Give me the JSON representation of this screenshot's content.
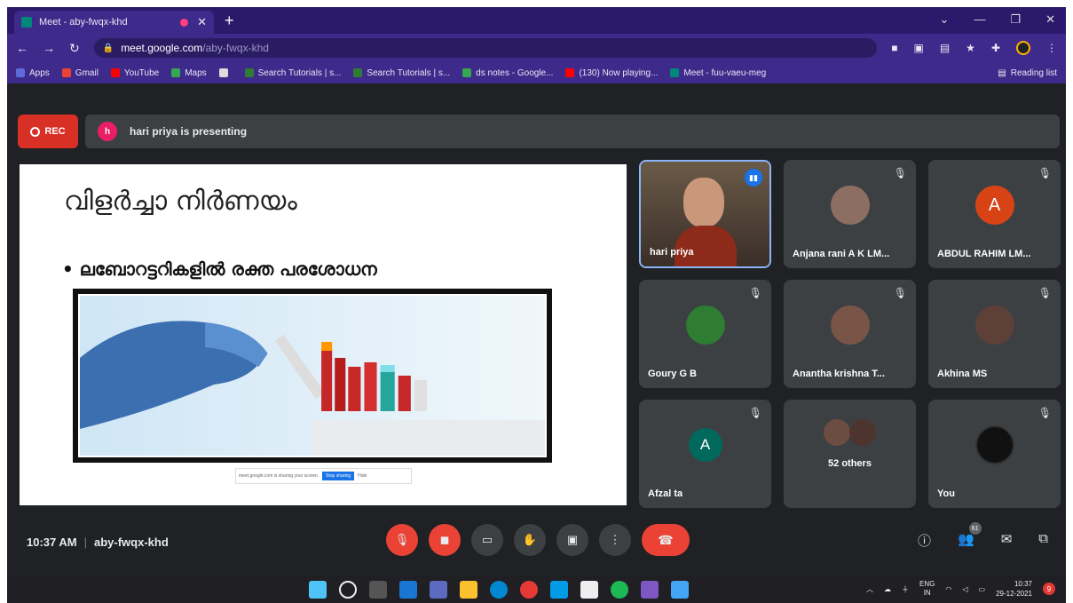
{
  "browser": {
    "tab_title": "Meet - aby-fwqx-khd",
    "new_tab": "+",
    "url_host": "meet.google.com",
    "url_path": "/aby-fwqx-khd",
    "bookmarks": [
      {
        "label": "Apps",
        "color": "#5f6bd8"
      },
      {
        "label": "Gmail",
        "color": "#ea4335"
      },
      {
        "label": "YouTube",
        "color": "#ff0000"
      },
      {
        "label": "Maps",
        "color": "#34a853"
      },
      {
        "label": "",
        "color": "#dddddd"
      },
      {
        "label": "Search Tutorials | s...",
        "color": "#2e7d32"
      },
      {
        "label": "Search Tutorials | s...",
        "color": "#2e7d32"
      },
      {
        "label": "ds notes - Google...",
        "color": "#34a853"
      },
      {
        "label": "(130) Now playing...",
        "color": "#ff0000"
      },
      {
        "label": "Meet - fuu-vaeu-meg",
        "color": "#00897b"
      }
    ],
    "reading_list": "Reading list"
  },
  "meet": {
    "rec_label": "REC",
    "presenter_initial": "h",
    "presenting_text": "hari priya is presenting",
    "slide": {
      "title": "വിളർച്ചാ നിർണയം",
      "bullet": "• ലബോറട്ടറികളിൽ രക്ത പരശോധന",
      "share_text": "meet.google.com is sharing your screen.",
      "stop_label": "Stop sharing",
      "hide_label": "Hide"
    },
    "participants": [
      {
        "name": "hari priya",
        "initial": "",
        "color": "#7a5a4a"
      },
      {
        "name": "Anjana rani A K LM...",
        "initial": "",
        "color": "#8d6e63"
      },
      {
        "name": "ABDUL RAHIM LM...",
        "initial": "A",
        "color": "#d84315"
      },
      {
        "name": "Goury G B",
        "initial": "",
        "color": "#2e7d32"
      },
      {
        "name": "Anantha krishna T...",
        "initial": "",
        "color": "#795548"
      },
      {
        "name": "Akhina MS",
        "initial": "",
        "color": "#5d4037"
      },
      {
        "name": "Afzal ta",
        "initial": "A",
        "color": "#00695c"
      },
      {
        "name": "52 others",
        "initial": "",
        "color": "#6d4c41"
      },
      {
        "name": "You",
        "initial": "",
        "color": "#111111"
      }
    ],
    "time": "10:37 AM",
    "meeting_code": "aby-fwqx-khd",
    "people_count": "61"
  },
  "taskbar": {
    "lang_top": "ENG",
    "lang_bottom": "IN",
    "time": "10:37",
    "date": "29-12-2021",
    "notifications": "9"
  }
}
